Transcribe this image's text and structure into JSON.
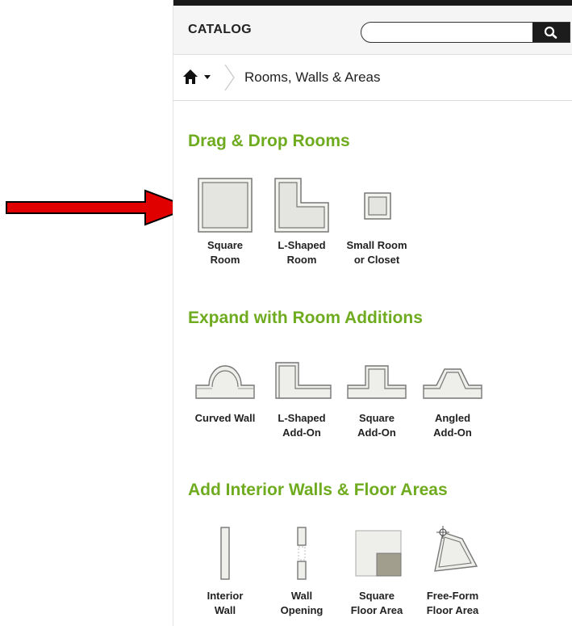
{
  "catalog": {
    "title": "CATALOG",
    "search": {
      "value": "",
      "placeholder": ""
    }
  },
  "breadcrumb": {
    "current": "Rooms, Walls & Areas"
  },
  "sections": [
    {
      "title": "Drag & Drop Rooms",
      "items": [
        {
          "icon": "square-room-icon",
          "label": "Square\nRoom"
        },
        {
          "icon": "l-shaped-room-icon",
          "label": "L-Shaped\nRoom"
        },
        {
          "icon": "small-room-icon",
          "label": "Small Room\nor Closet"
        }
      ]
    },
    {
      "title": "Expand with Room Additions",
      "items": [
        {
          "icon": "curved-wall-icon",
          "label": "Curved Wall"
        },
        {
          "icon": "l-shaped-addon-icon",
          "label": "L-Shaped\nAdd-On"
        },
        {
          "icon": "square-addon-icon",
          "label": "Square\nAdd-On"
        },
        {
          "icon": "angled-addon-icon",
          "label": "Angled\nAdd-On"
        }
      ]
    },
    {
      "title": "Add Interior Walls & Floor Areas",
      "items": [
        {
          "icon": "interior-wall-icon",
          "label": "Interior\nWall"
        },
        {
          "icon": "wall-opening-icon",
          "label": "Wall\nOpening"
        },
        {
          "icon": "square-floor-area-icon",
          "label": "Square\nFloor Area"
        },
        {
          "icon": "free-form-floor-area-icon",
          "label": "Free-Form\nFloor Area"
        }
      ]
    }
  ],
  "colors": {
    "accent": "#6fab1f",
    "arrow": "#e00000"
  }
}
